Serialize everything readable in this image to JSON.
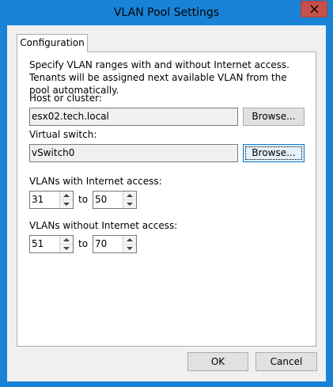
{
  "window": {
    "title": "VLAN Pool Settings",
    "accent_color": "#1883d7",
    "close_button_color": "#c7504b"
  },
  "tabs": [
    {
      "label": "Configuration",
      "selected": true
    }
  ],
  "description": "Specify VLAN ranges with and without Internet access. Tenants will be assigned next available VLAN from the pool automatically.",
  "host": {
    "label": "Host or cluster:",
    "value": "esx02.tech.local",
    "browse_label": "Browse..."
  },
  "vswitch": {
    "label": "Virtual switch:",
    "value": "vSwitch0",
    "browse_label": "Browse..."
  },
  "with_internet": {
    "label": "VLANs with Internet access:",
    "from": "31",
    "to_label": "to",
    "to": "50"
  },
  "without_internet": {
    "label": "VLANs without Internet access:",
    "from": "51",
    "to_label": "to",
    "to": "70"
  },
  "footer": {
    "ok_label": "OK",
    "cancel_label": "Cancel"
  }
}
